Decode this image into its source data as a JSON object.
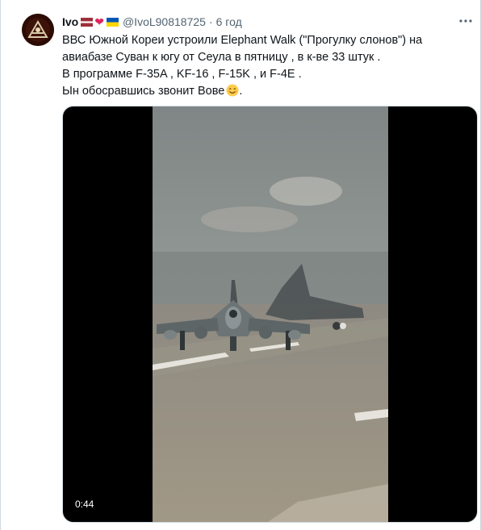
{
  "author": {
    "name": "Ivo",
    "handle": "@IvoL90818725",
    "separator": "·",
    "time": "6 год",
    "badges": [
      "latvia-flag-icon",
      "red-heart-icon",
      "ukraine-flag-icon"
    ]
  },
  "tweet": {
    "lines": [
      "ВВС Южной Кореи устроили Elephant Walk (\"Прогулку слонов\") на",
      "авиабазе Суван к югу от Сеула в пятницу , в к-ве 33 штук .",
      "В программе F-35A , KF-16 , F-15K , и F-4E .",
      "Ын обосравшись звонит Вове"
    ],
    "line4_emoji": "smiling-face-icon",
    "line4_suffix": "."
  },
  "media": {
    "type": "video",
    "duration": "0:44"
  },
  "colors": {
    "text": "#0f1419",
    "secondary": "#536471",
    "border": "#cfd9de"
  }
}
